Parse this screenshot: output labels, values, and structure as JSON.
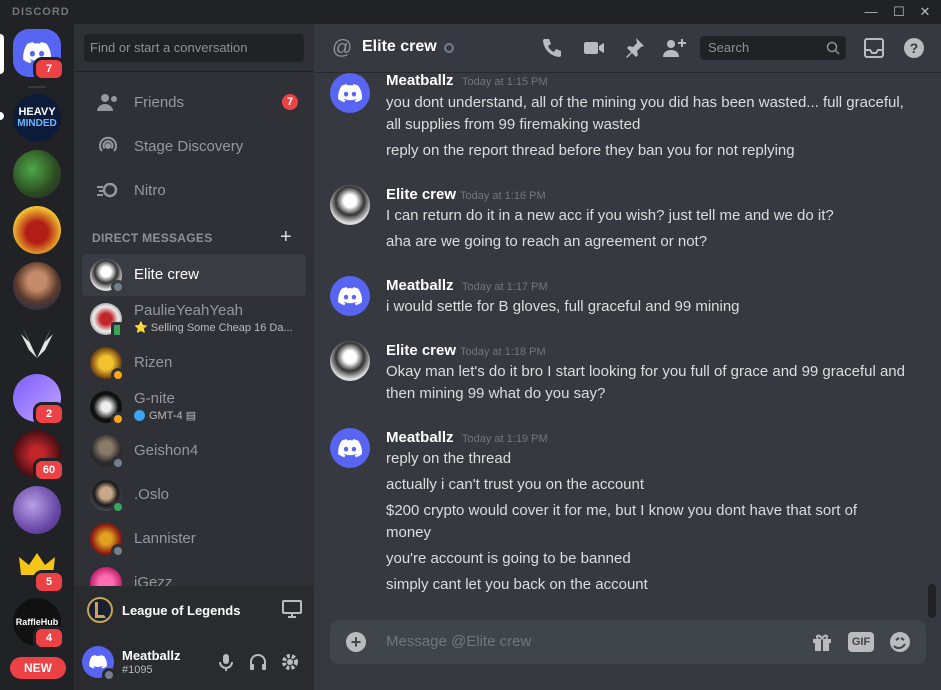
{
  "app": {
    "brand": "DISCORD"
  },
  "window_controls": [
    "minimize",
    "maximize",
    "close"
  ],
  "guilds": [
    {
      "name": "home",
      "badge": "7",
      "icon": "discord-logo-icon"
    },
    {
      "name": "heavy-minded",
      "text": "HEAVY MINDED",
      "badge": ""
    },
    {
      "name": "green-server",
      "badge": ""
    },
    {
      "name": "red-demon-server",
      "badge": ""
    },
    {
      "name": "portrait-server",
      "badge": ""
    },
    {
      "name": "wings-server",
      "badge": ""
    },
    {
      "name": "purple-server",
      "badge": "2"
    },
    {
      "name": "red-server",
      "badge": "60"
    },
    {
      "name": "violet-server",
      "badge": ""
    },
    {
      "name": "crown-server",
      "badge": "5"
    },
    {
      "name": "raffle-hub",
      "text": "RaffleHub",
      "badge": "4"
    }
  ],
  "new_badge": "NEW",
  "sidebar": {
    "search_placeholder": "Find or start a conversation",
    "nav": [
      {
        "label": "Friends",
        "icon": "friends-icon",
        "badge": "7"
      },
      {
        "label": "Stage Discovery",
        "icon": "stage-icon",
        "badge": ""
      },
      {
        "label": "Nitro",
        "icon": "nitro-icon",
        "badge": ""
      }
    ],
    "dm_header": "DIRECT MESSAGES",
    "dms": [
      {
        "name": "Elite crew",
        "status": "offline",
        "sub": ""
      },
      {
        "name": "PaulieYeahYeah",
        "status": "mobile",
        "sub": "⭐ Selling Some Cheap 16 Da..."
      },
      {
        "name": "Rizen",
        "status": "idle",
        "sub": ""
      },
      {
        "name": "G-nite",
        "status": "idle",
        "sub": "GMT-4"
      },
      {
        "name": "Geishon4",
        "status": "offline",
        "sub": ""
      },
      {
        "name": ".Oslo",
        "status": "online",
        "sub": ""
      },
      {
        "name": "Lannister",
        "status": "offline",
        "sub": ""
      },
      {
        "name": "iGezz",
        "status": "offline",
        "sub": ""
      }
    ],
    "activity": {
      "game": "League of Legends"
    },
    "user": {
      "name": "Meatballz",
      "tag": "#1095"
    }
  },
  "chat": {
    "channel": "Elite crew",
    "search_placeholder": "Search",
    "messages": [
      {
        "author": "Meatballz",
        "time": "Today at 1:15 PM",
        "avatar": "discord",
        "lines": [
          "you dont understand, all of the mining you did has been wasted... full graceful, all supplies from 99 firemaking wasted",
          "reply on the report thread before they ban you for not replying"
        ]
      },
      {
        "author": "Elite crew",
        "time": "Today at 1:16 PM",
        "avatar": "elite",
        "lines": [
          "I can return do it in a new acc if you wish? just tell me and we do it?",
          "aha are we going to reach an agreement or not?"
        ]
      },
      {
        "author": "Meatballz",
        "time": "Today at 1:17 PM",
        "avatar": "discord",
        "lines": [
          "i would settle for B gloves, full graceful and 99 mining"
        ]
      },
      {
        "author": "Elite crew",
        "time": "Today at 1:18 PM",
        "avatar": "elite",
        "lines": [
          "Okay man let's do it bro I start looking for you full of grace and 99 graceful and then mining 99 what do you say?"
        ]
      },
      {
        "author": "Meatballz",
        "time": "Today at 1:19 PM",
        "avatar": "discord",
        "lines": [
          "reply on the thread",
          "actually i can't trust you on the account",
          "$200 crypto would cover it for me, but I know you dont have that sort of money",
          "you're account is going to be banned",
          "simply cant let you back on the account"
        ]
      }
    ],
    "composer_placeholder": "Message @Elite crew",
    "composer_gif": "GIF"
  },
  "colors": {
    "blurple": "#5865f2",
    "red": "#ed4245",
    "online": "#3ba55d",
    "idle": "#faa81a",
    "offline": "#747f8d"
  }
}
